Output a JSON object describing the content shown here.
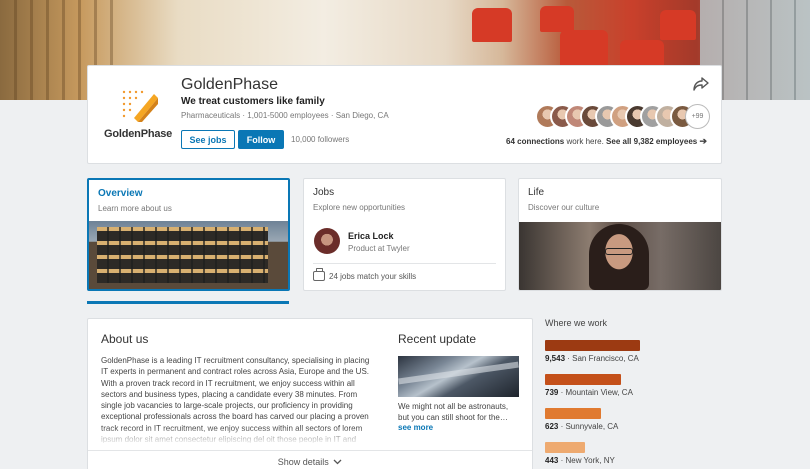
{
  "company": {
    "name": "GoldenPhase",
    "tagline": "We treat customers like family",
    "meta": "Pharmaceuticals · 1,001-5000 employees · San Diego, CA",
    "logo_text": "GoldenPhase",
    "followers": "10,000 followers"
  },
  "actions": {
    "see_jobs": "See jobs",
    "follow": "Follow"
  },
  "connections": {
    "more_badge": "+99",
    "count_text": "64 connections",
    "suffix": " work here. ",
    "see_all": "See all 9,382 employees",
    "arrow": "➔",
    "avatar_colors": [
      "#b07a5a",
      "#8a5a4a",
      "#c08878",
      "#6a4a3a",
      "#9a9a9a",
      "#d0a080",
      "#4a3a30",
      "#a0a0a0",
      "#c0b0a0",
      "#7a5a40"
    ]
  },
  "tabs": [
    {
      "title": "Overview",
      "subtitle": "Learn more about us"
    },
    {
      "title": "Jobs",
      "subtitle": "Explore new opportunities"
    },
    {
      "title": "Life",
      "subtitle": "Discover our culture"
    }
  ],
  "jobs_tab": {
    "person_name": "Erica Lock",
    "person_role": "Product at Twyler",
    "match_text": "24 jobs match your skills"
  },
  "about": {
    "title": "About us",
    "text": "GoldenPhase is a leading IT recruitment consultancy, specialising in placing IT experts in permanent and contract roles across Asia, Europe and the US. With a proven track record in IT recruitment, we enjoy success within all sectors and business types, placing a candidate every 38 minutes. From single job vacancies to large-scale projects, our proficiency in providing exceptional professionals across the board has carved our placing a proven track record in IT recruitment, we enjoy success within all sectors of lorem ipsum dolor sit amet consectetur elipiscing del oit those people in IT and"
  },
  "recent": {
    "title": "Recent update",
    "text": "We might not all be astronauts, but you can still shoot for the…",
    "see_more": "see more"
  },
  "show_details": "Show details",
  "where_we_work": {
    "title": "Where we work",
    "locations": [
      {
        "count": "9,543",
        "place": " · San Francisco, CA",
        "fraction": 1.0,
        "color": "#9c3a12"
      },
      {
        "count": "739",
        "place": " · Mountain View, CA",
        "fraction": 0.8,
        "color": "#c4501a"
      },
      {
        "count": "623",
        "place": " · Sunnyvale, CA",
        "fraction": 0.59,
        "color": "#e07a30"
      },
      {
        "count": "443",
        "place": " · New York, NY",
        "fraction": 0.42,
        "color": "#eeaa70"
      }
    ]
  }
}
